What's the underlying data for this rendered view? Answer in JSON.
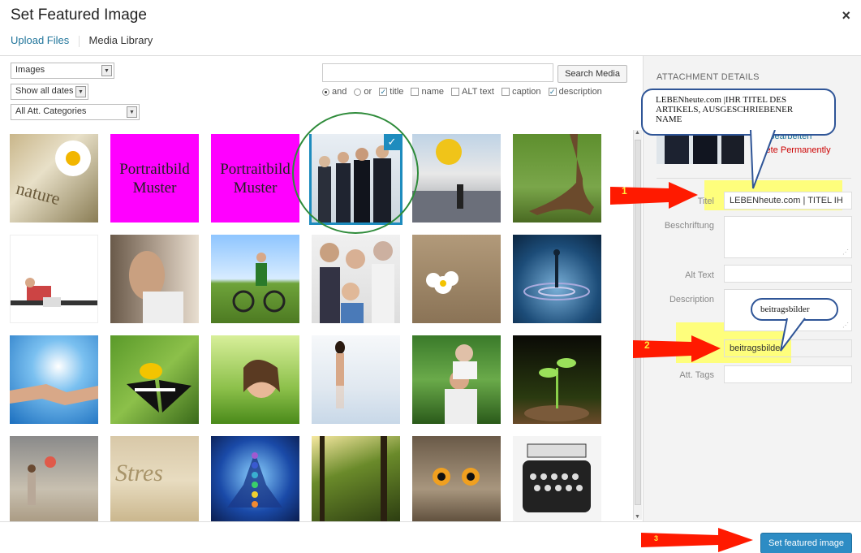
{
  "header": {
    "title": "Set Featured Image",
    "close_icon": "×"
  },
  "tabs": [
    {
      "label": "Upload Files",
      "active": false
    },
    {
      "label": "Media Library",
      "active": true
    }
  ],
  "filters": {
    "type_select": "Images",
    "date_select": "Show all dates",
    "category_select": "All Att. Categories"
  },
  "search": {
    "value": "",
    "button_label": "Search Media",
    "mode_and": "and",
    "mode_or": "or",
    "fields": [
      {
        "label": "title",
        "checked": true
      },
      {
        "label": "name",
        "checked": false
      },
      {
        "label": "ALT text",
        "checked": false
      },
      {
        "label": "caption",
        "checked": false
      },
      {
        "label": "description",
        "checked": true
      }
    ]
  },
  "grid": {
    "items": [
      {
        "name": "nature-daisy-thumbnail",
        "text": "",
        "selected": false
      },
      {
        "name": "portraitbild-muster-1",
        "text": "Portraitbild Muster",
        "selected": false
      },
      {
        "name": "portraitbild-muster-2",
        "text": "Portraitbild Muster",
        "selected": false
      },
      {
        "name": "business-team-thumbnail",
        "text": "",
        "selected": true
      },
      {
        "name": "crowd-balloon-thumbnail",
        "text": "",
        "selected": false
      },
      {
        "name": "tree-roots-thumbnail",
        "text": "",
        "selected": false
      },
      {
        "name": "woman-laptop-thumbnail",
        "text": "",
        "selected": false
      },
      {
        "name": "stressed-woman-thumbnail",
        "text": "",
        "selected": false
      },
      {
        "name": "cyclists-thumbnail",
        "text": "",
        "selected": false
      },
      {
        "name": "family-thumbs-up-thumbnail",
        "text": "",
        "selected": false
      },
      {
        "name": "flower-in-dirt-thumbnail",
        "text": "",
        "selected": false
      },
      {
        "name": "water-drop-thumbnail",
        "text": "",
        "selected": false
      },
      {
        "name": "handshake-thumbnail",
        "text": "",
        "selected": false
      },
      {
        "name": "butterfly-thumbnail",
        "text": "",
        "selected": false
      },
      {
        "name": "woman-grass-thumbnail",
        "text": "",
        "selected": false
      },
      {
        "name": "woman-water-thumbnail",
        "text": "",
        "selected": false
      },
      {
        "name": "seniors-piggyback-thumbnail",
        "text": "",
        "selected": false
      },
      {
        "name": "sprout-thumbnail",
        "text": "",
        "selected": false
      },
      {
        "name": "girl-pinwheel-thumbnail",
        "text": "",
        "selected": false
      },
      {
        "name": "stress-sand-thumbnail",
        "text": "",
        "selected": false
      },
      {
        "name": "meditation-chakra-thumbnail",
        "text": "",
        "selected": false
      },
      {
        "name": "forest-sunrays-thumbnail",
        "text": "",
        "selected": false
      },
      {
        "name": "owl-thumbnail",
        "text": "",
        "selected": false
      },
      {
        "name": "typewriter-thumbnail",
        "text": "",
        "selected": false
      }
    ]
  },
  "details": {
    "heading": "ATTACHMENT DETAILS",
    "edit_link": "Bild bearbeiten",
    "delete_link": "Delete Permanently",
    "fields": {
      "title_label": "Titel",
      "title_value": "LEBENheute.com |  TITEL IH",
      "caption_label": "Beschriftung",
      "caption_value": "",
      "alt_label": "Alt Text",
      "alt_value": "",
      "description_label": "Description",
      "description_value": "",
      "category_value": "beitragsbilder",
      "tags_label": "Att. Tags",
      "tags_value": ""
    }
  },
  "annotations": {
    "callout_title": "LEBENheute.com |IHR TITEL DES ARTIKELS, AUSGESCHRIEBENER NAME",
    "callout_category": "beitragsbilder",
    "step1": "1",
    "step2": "2",
    "step3": "3",
    "arrow_color": "#ff1a00",
    "highlight_color": "#ffff66",
    "circle_color": "#2e8b3a"
  },
  "footer": {
    "button_label": "Set featured image"
  }
}
